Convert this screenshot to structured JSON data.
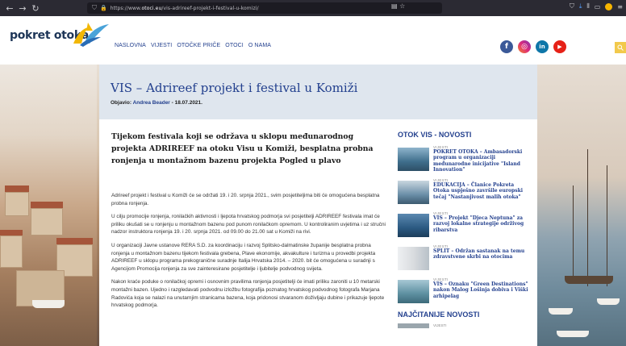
{
  "browser": {
    "url_prefix": "https://www.",
    "url_domain": "otoci.eu",
    "url_path": "/vis-adrireef-projekt-i-festival-u-komizi/"
  },
  "site": {
    "logo_text": "pokret otoka",
    "nav": [
      "NASLOVNA",
      "VIJESTI",
      "OTOČKE PRIČE",
      "OTOCI",
      "O NAMA"
    ],
    "socials": [
      {
        "name": "facebook",
        "glyph": "f",
        "color": "#3b5998"
      },
      {
        "name": "instagram",
        "glyph": "◎",
        "color": "#e1306c"
      },
      {
        "name": "linkedin",
        "glyph": "in",
        "color": "#0e76a8"
      },
      {
        "name": "youtube",
        "glyph": "▶",
        "color": "#e62117"
      }
    ]
  },
  "article": {
    "title": "VIS – Adrireef projekt i festival u Komiži",
    "byline_prefix": "Objavio:",
    "author": "Andrea Beader",
    "date": "- 18.07.2021.",
    "lead": "Tijekom festivala koji se održava u sklopu međunarodnog projekta ADRIREEF na otoku Visu u Komiži,  besplatna probna ronjenja u montažnom bazenu projekta Pogled u plavo",
    "paragraphs": [
      "Adrireef projekt i festival u Komiži će se održati 19. i 20. srpnja 2021., svim posjetiteljima biti će omogućena besplatna probna ronjenja.",
      "U cilju promocije ronjenja, ronilačkih aktivnosti i ljepota hrvatskog podmorja svi posjetitelji ADRIREEF festivala imat će priliku okušati se u ronjenju u montažnom bazenu pod punom ronilačkom opremom. U kontroliranim uvjetima i uz stručni nadzor instruktora ronjenja 19. i 20. srpnja 2021. od 09.00 do 21.00 sat u Komiži na rivi.",
      "U organizaciji Javne ustanove RERA S.D. za koordinaciju i razvoj Splitsko-dalmatinske županije besplatna probna ronjenja u montažnom bazenu tijekom festivala grebena, Plave ekonomije, akvakulture i turizma u provedbi projekta ADRIREEF u sklopu programa prekogranične suradnje Italija Hrvatska 2014. – 2020. bit će omogućena u suradnji s Agencijom Promocija ronjenja za sve zainteresirane posjetitelje i ljubitelje podvodnog svijeta.",
      "Nakon kraće poduke o ronilačkoj opremi i osnovnim pravilima ronjenja posjetitelji će imati priliku zaroniti u 10 metarski montažni bazen. Ujedno i razgledavati podvodnu izložbu fotografija poznatog hrvatskog podvodnog fotografa Marjana Radovića koja se nalazi na unutarnjim stranicama bazena, koja pridonosi stvaranom doživljaju dubine i prikazuje ljepote hrvatskog podmorja."
    ]
  },
  "sidebar": {
    "heading": "OTOK VIS - NOVOSTI",
    "items": [
      {
        "tag": "VIJESTI",
        "title": "POKRET OTOKA – Ambasadorski program u organizaciji međunarodne inicijative \"Island Innovation\"",
        "thumb": "#3f6e8c"
      },
      {
        "tag": "VIJESTI",
        "title": "EDUKACIJA – Članice Pokreta Otoka uspješno završile europski tečaj \"Nastanjivost malih otoka\"",
        "thumb": "#6b8fa8"
      },
      {
        "tag": "VIJESTI",
        "title": "VIS – Projekt \"Djeca Neptuna\" za razvoj lokalne strategije održivog ribarstva",
        "thumb": "#2c5a82"
      },
      {
        "tag": "VIJESTI",
        "title": "SPLIT – Održan sastanak na temu zdravstvene skrbi na otocima",
        "thumb": "#d9dcdf"
      },
      {
        "tag": "VIJESTI",
        "title": "VIS – Oznaku \"Green Destinations\" nakon Malog Lošinja dobiva i Viški arhipelag",
        "thumb": "#5d8fa0"
      }
    ],
    "heading2": "NAJČITANIJE NOVOSTI",
    "tag2": "VIJESTI"
  }
}
